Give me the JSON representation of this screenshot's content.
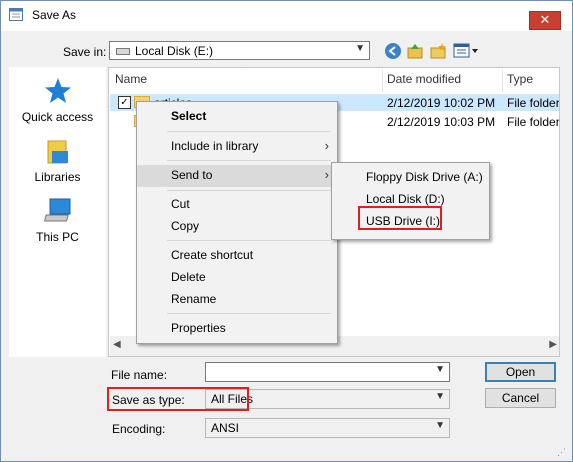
{
  "window": {
    "title": "Save As",
    "close_glyph": "✕"
  },
  "save_in": {
    "label": "Save in:",
    "value": "Local Disk (E:)"
  },
  "toolbar": {
    "icons": [
      "back-icon",
      "up-folder-icon",
      "new-folder-icon",
      "view-menu-icon"
    ]
  },
  "sidebar": {
    "items": [
      {
        "label": "Quick access",
        "icon": "star-icon"
      },
      {
        "label": "Libraries",
        "icon": "libraries-icon"
      },
      {
        "label": "This PC",
        "icon": "computer-icon"
      }
    ]
  },
  "columns": {
    "name": "Name",
    "date": "Date modified",
    "type": "Type"
  },
  "files": [
    {
      "name": "articles",
      "date": "2/12/2019 10:02 PM",
      "type": "File folder",
      "checked": true
    },
    {
      "name": "",
      "date": "2/12/2019 10:03 PM",
      "type": "File folder",
      "checked": false
    }
  ],
  "context_menu": {
    "items": [
      "Select",
      "Include in library",
      "Send to",
      "Cut",
      "Copy",
      "Create shortcut",
      "Delete",
      "Rename",
      "Properties"
    ]
  },
  "send_to_menu": {
    "items": [
      "Floppy Disk Drive (A:)",
      "Local Disk (D:)",
      "USB Drive (I:)"
    ]
  },
  "form": {
    "file_name_label": "File name:",
    "file_name_value": "",
    "save_type_label": "Save as type:",
    "save_type_value": "All Files",
    "encoding_label": "Encoding:",
    "encoding_value": "ANSI"
  },
  "buttons": {
    "open": "Open",
    "cancel": "Cancel"
  },
  "colors": {
    "highlight": "#e02020",
    "selection": "#cce8ff",
    "close": "#c84031"
  }
}
